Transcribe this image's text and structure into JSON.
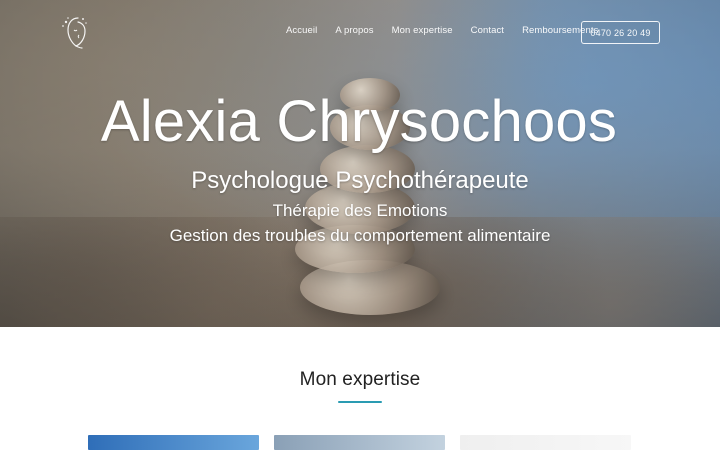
{
  "nav": {
    "links": [
      "Accueil",
      "A propos",
      "Mon expertise",
      "Contact",
      "Remboursements"
    ],
    "phone": "0470 26 20 49"
  },
  "hero": {
    "name": "Alexia Chrysochoos",
    "subtitle": "Psychologue Psychothérapeute",
    "line2": "Thérapie des Emotions",
    "line3": "Gestion des troubles du comportement alimentaire"
  },
  "section": {
    "title": "Mon expertise",
    "accent_color": "#2a9bb2"
  },
  "icons": {
    "logo": "face-logo-icon"
  }
}
